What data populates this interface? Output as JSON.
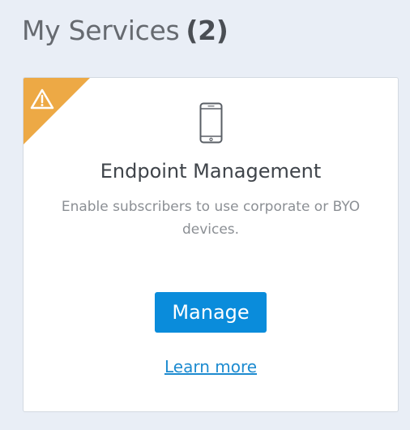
{
  "header": {
    "title": "My Services",
    "count": "(2)"
  },
  "card": {
    "warning_icon": "warning-triangle-icon",
    "warning_color": "#eda945",
    "service_icon": "smartphone-icon",
    "title": "Endpoint Management",
    "description": "Enable subscribers to use corporate or BYO devices.",
    "manage_label": "Manage",
    "learn_more_label": "Learn more"
  },
  "colors": {
    "background": "#e9eef6",
    "button": "#0a8cdb",
    "link": "#1d8bd0"
  }
}
